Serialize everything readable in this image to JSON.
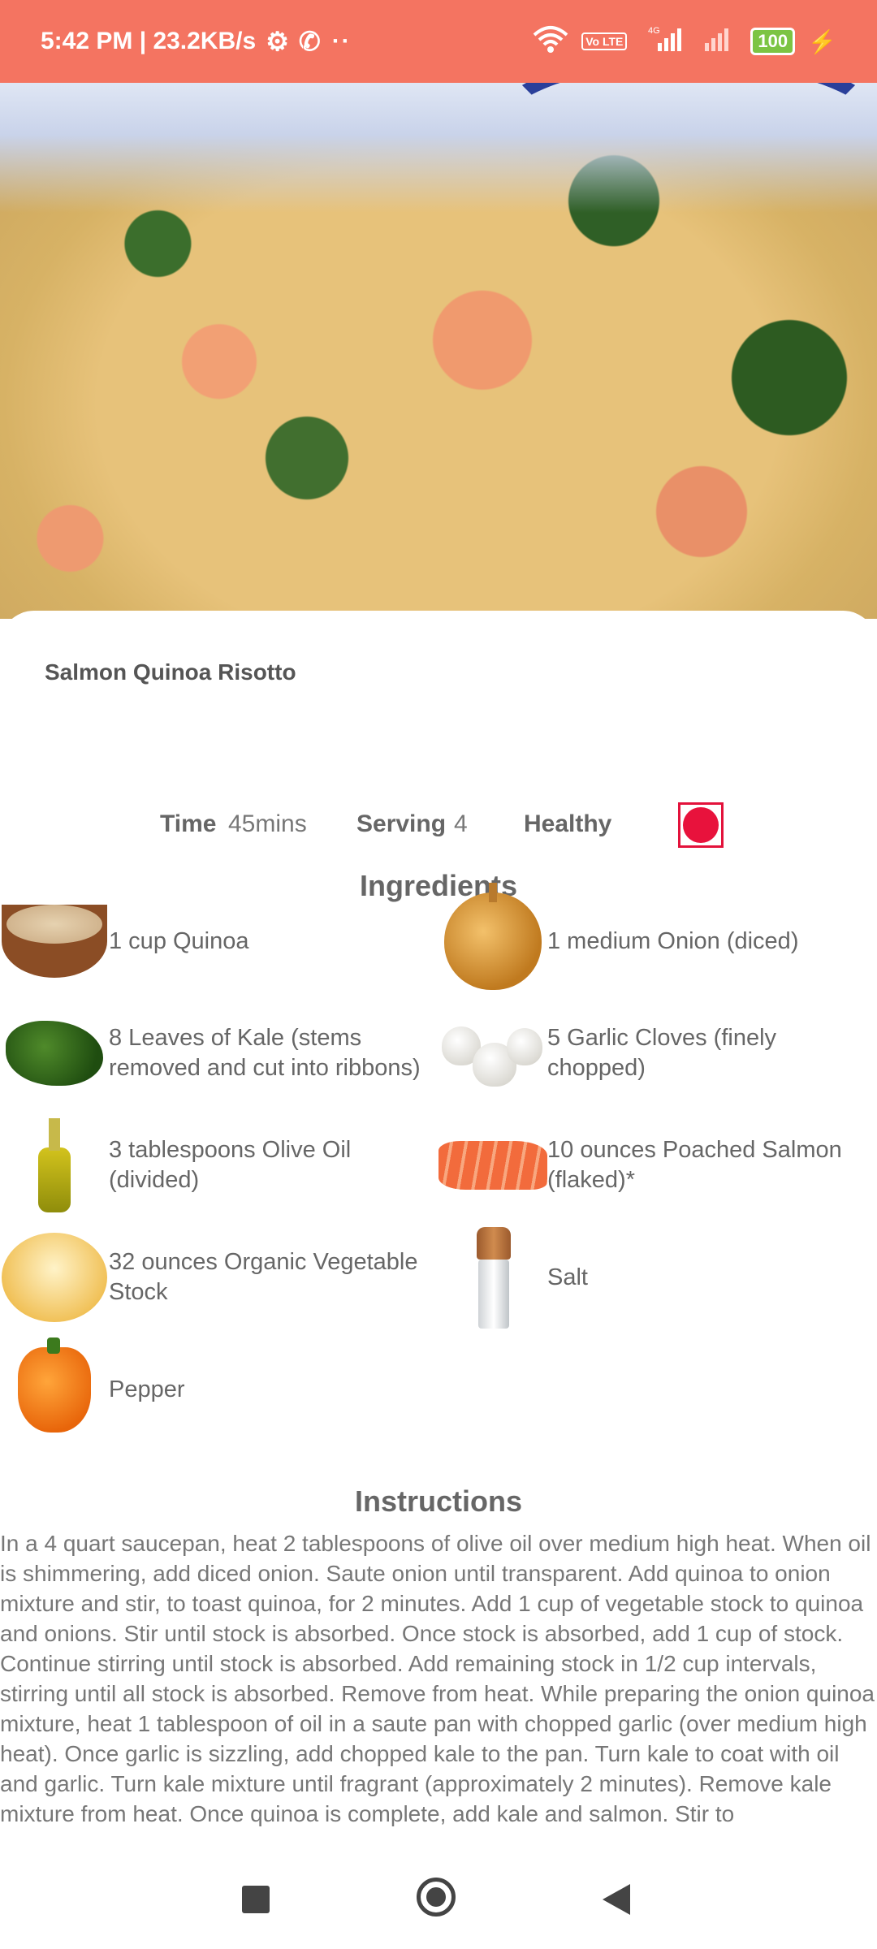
{
  "status_bar": {
    "time_speed": "5:42 PM | 23.2KB/s",
    "battery": "100",
    "network": "4G",
    "volte": "Vo LTE"
  },
  "recipe": {
    "title": "Salmon Quinoa Risotto",
    "time_label": "Time",
    "time_value": "45mins",
    "serving_label": "Serving",
    "serving_value": "4",
    "healthy_label": "Healthy"
  },
  "ingredients_title": "Ingredients",
  "ingredients": [
    {
      "text": "1 cup Quinoa",
      "icon": "quinoa-icon"
    },
    {
      "text": "1 medium Onion (diced)",
      "icon": "onion-icon"
    },
    {
      "text": "8 Leaves of Kale (stems removed and cut into ribbons)",
      "icon": "kale-icon"
    },
    {
      "text": "5 Garlic Cloves (finely chopped)",
      "icon": "garlic-icon"
    },
    {
      "text": "3 tablespoons Olive Oil (divided)",
      "icon": "olive-oil-icon"
    },
    {
      "text": "10 ounces Poached Salmon (flaked)*",
      "icon": "salmon-icon"
    },
    {
      "text": "32 ounces Organic Vegetable Stock",
      "icon": "vegetable-stock-icon"
    },
    {
      "text": "Salt",
      "icon": "salt-icon"
    },
    {
      "text": "Pepper",
      "icon": "pepper-icon"
    }
  ],
  "instructions_title": "Instructions",
  "instructions_text": "In a 4 quart saucepan, heat 2 tablespoons of olive oil over medium high heat. When oil is shimmering, add diced onion. Saute onion until transparent. Add quinoa to onion mixture and stir, to toast quinoa, for 2 minutes. Add 1 cup of vegetable stock to quinoa and onions. Stir until stock is absorbed. Once stock is absorbed, add 1 cup of stock. Continue stirring until stock is absorbed. Add remaining stock in 1/2 cup intervals, stirring until all stock is absorbed. Remove from heat. While preparing the onion quinoa mixture, heat 1 tablespoon of oil in a saute pan with chopped garlic (over medium high heat). Once garlic is sizzling, add chopped kale to the pan. Turn kale to coat with oil and garlic. Turn kale mixture until fragrant (approximately 2 minutes). Remove kale mixture from heat. Once quinoa is complete, add kale and salmon. Stir to",
  "colors": {
    "status_bar": "#F47461",
    "favorite": "#E8123C"
  }
}
